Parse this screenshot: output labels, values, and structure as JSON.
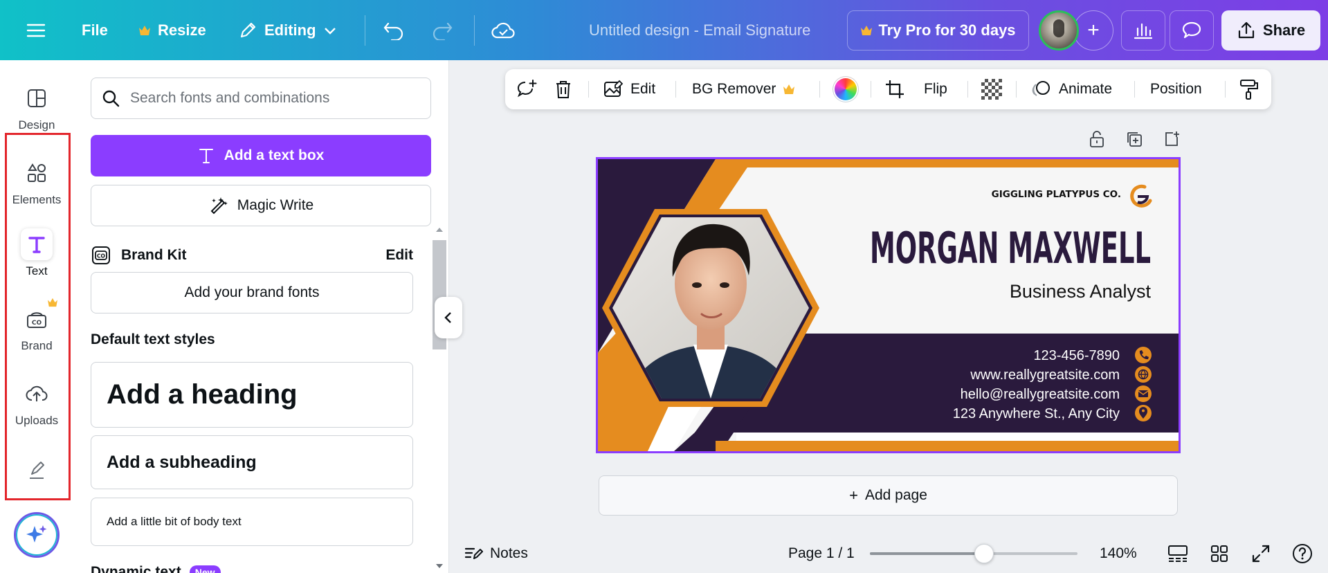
{
  "topbar": {
    "file_label": "File",
    "resize_label": "Resize",
    "editing_label": "Editing",
    "doc_title": "Untitled design - Email Signature",
    "pro_label": "Try Pro for 30 days",
    "share_label": "Share"
  },
  "rail": {
    "items": [
      {
        "label": "Design",
        "icon": "design-icon"
      },
      {
        "label": "Elements",
        "icon": "elements-icon"
      },
      {
        "label": "Text",
        "icon": "text-icon"
      },
      {
        "label": "Brand",
        "icon": "brand-icon"
      },
      {
        "label": "Uploads",
        "icon": "uploads-icon"
      }
    ],
    "active": "Text"
  },
  "panel": {
    "search_placeholder": "Search fonts and combinations",
    "add_textbox_label": "Add a text box",
    "magic_write_label": "Magic Write",
    "brand_kit_label": "Brand Kit",
    "brand_kit_edit": "Edit",
    "add_brand_fonts": "Add your brand fonts",
    "default_styles_label": "Default text styles",
    "heading": "Add a heading",
    "subheading": "Add a subheading",
    "body": "Add a little bit of body text",
    "dynamic_label": "Dynamic text",
    "new_badge": "New"
  },
  "context_toolbar": {
    "edit_label": "Edit",
    "bg_remover_label": "BG Remover",
    "flip_label": "Flip",
    "animate_label": "Animate",
    "position_label": "Position"
  },
  "design": {
    "company": "GIGGLING PLATYPUS CO.",
    "name": "MORGAN MAXWELL",
    "role": "Business Analyst",
    "phone": "123-456-7890",
    "website": "www.reallygreatsite.com",
    "email": "hello@reallygreatsite.com",
    "address": "123 Anywhere St., Any City",
    "colors": {
      "navy": "#2a1a3d",
      "orange": "#e58c1f",
      "white": "#ffffff"
    }
  },
  "canvas": {
    "add_page_label": "Add page"
  },
  "footer": {
    "notes_label": "Notes",
    "page_label": "Page 1 / 1",
    "zoom_label": "140%",
    "zoom_fraction": 0.55
  }
}
